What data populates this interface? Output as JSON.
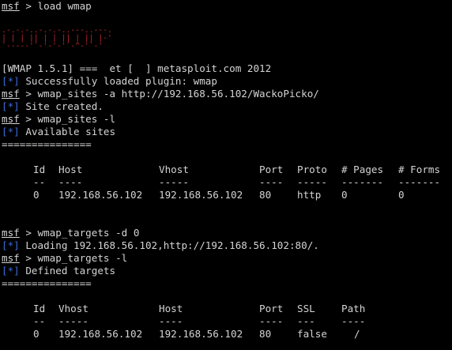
{
  "prompt": "msf",
  "commands": {
    "load": "> load wmap",
    "sites_add": "> wmap_sites -a http://192.168.56.102/WackoPicko/",
    "sites_list": "> wmap_sites -l",
    "targets_define": "> wmap_targets -d 0",
    "targets_list": "> wmap_targets -l"
  },
  "banner": {
    "row1": ".-.-.-..-.-.-..---..---.",
    "row2": "| | | || | | || | || |-'",
    "row3": "`-----'`-'-'-'`-^-'`-'"
  },
  "version_line": "[WMAP 1.5.1] ===  et [  ] metasploit.com 2012",
  "marker": "[*]",
  "messages": {
    "plugin_loaded": " Successfully loaded plugin: wmap",
    "site_created": " Site created.",
    "available_sites": " Available sites",
    "loading": " Loading 192.168.56.102,http://192.168.56.102:80/.",
    "defined_targets": " Defined targets"
  },
  "separator": "===============",
  "sites_table": {
    "headers": [
      "Id",
      "Host",
      "Vhost",
      "Port",
      "Proto",
      "# Pages",
      "# Forms"
    ],
    "dashes": [
      "--",
      "----",
      "-----",
      "----",
      "-----",
      "-------",
      "-------"
    ],
    "rows": [
      [
        "0",
        "192.168.56.102",
        "192.168.56.102",
        "80",
        "http",
        "0",
        "0"
      ]
    ]
  },
  "targets_table": {
    "headers": [
      "Id",
      "Vhost",
      "Host",
      "Port",
      "SSL",
      "Path"
    ],
    "dashes": [
      "--",
      "-----",
      "----",
      "----",
      "---",
      "----"
    ],
    "rows": [
      [
        "0",
        "192.168.56.102",
        "192.168.56.102",
        "80",
        "false",
        "/"
      ]
    ]
  },
  "colors": {
    "background": "#000000",
    "text": "#d4d4d4",
    "marker": "#3a6cd8",
    "banner": "#c0262a"
  }
}
